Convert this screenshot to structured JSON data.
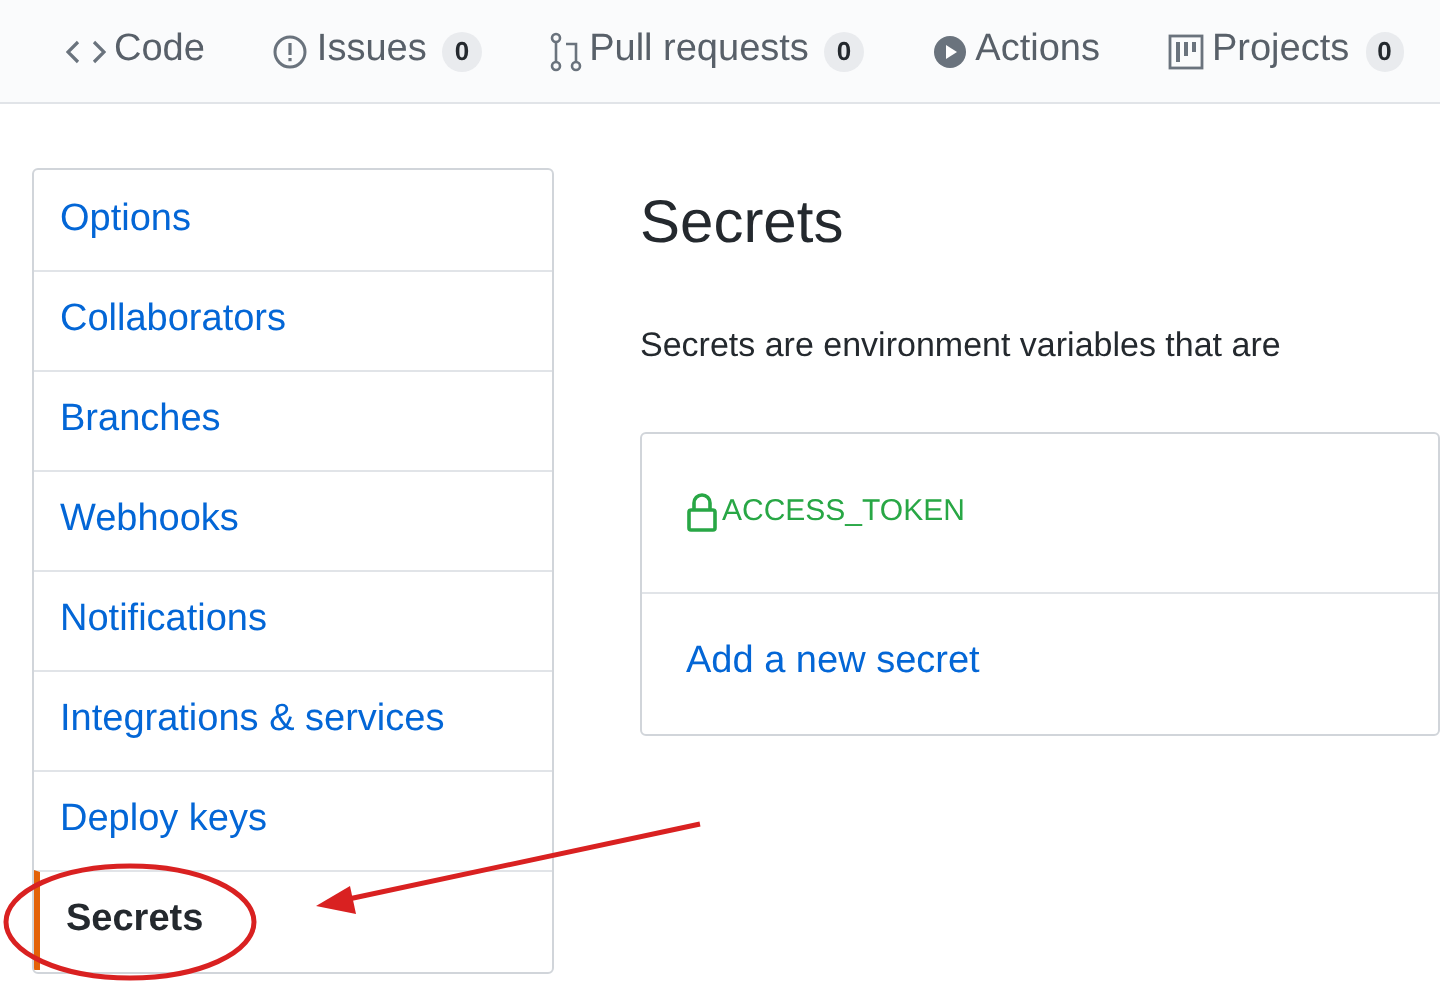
{
  "repo_nav": [
    {
      "kind": "code",
      "label": "Code"
    },
    {
      "kind": "issues",
      "label": "Issues",
      "count": "0"
    },
    {
      "kind": "pull",
      "label": "Pull requests",
      "count": "0"
    },
    {
      "kind": "actions",
      "label": "Actions"
    },
    {
      "kind": "projects",
      "label": "Projects",
      "count": "0"
    }
  ],
  "sidebar": {
    "items": [
      {
        "label": "Options",
        "selected": false
      },
      {
        "label": "Collaborators",
        "selected": false
      },
      {
        "label": "Branches",
        "selected": false
      },
      {
        "label": "Webhooks",
        "selected": false
      },
      {
        "label": "Notifications",
        "selected": false
      },
      {
        "label": "Integrations & services",
        "selected": false
      },
      {
        "label": "Deploy keys",
        "selected": false
      },
      {
        "label": "Secrets",
        "selected": true
      }
    ]
  },
  "main": {
    "title": "Secrets",
    "description": "Secrets are environment variables that are",
    "secrets": [
      {
        "name": "ACCESS_TOKEN"
      }
    ],
    "add_link": "Add a new secret"
  }
}
